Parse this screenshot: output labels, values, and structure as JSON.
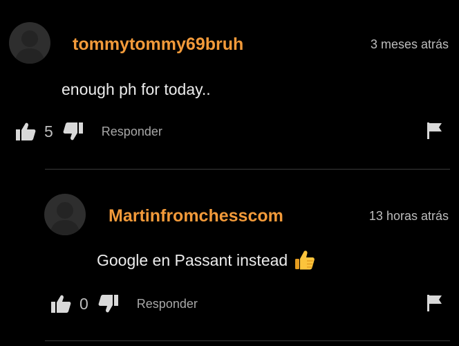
{
  "comments": [
    {
      "username": "tommytommy69bruh",
      "timestamp": "3 meses atrás",
      "text": "enough ph for today..",
      "likes": "5",
      "reply_label": "Responder",
      "emoji": ""
    },
    {
      "username": "Martinfromchesscom",
      "timestamp": "13 horas atrás",
      "text": "Google en Passant instead",
      "likes": "0",
      "reply_label": "Responder",
      "emoji": "thumbs-up-emoji"
    }
  ],
  "colors": {
    "background": "#000000",
    "username": "#f29a3a",
    "text": "#ececec",
    "muted": "#bdbdbd",
    "divider": "#3a3a3a",
    "icon": "#d9d9d9"
  }
}
